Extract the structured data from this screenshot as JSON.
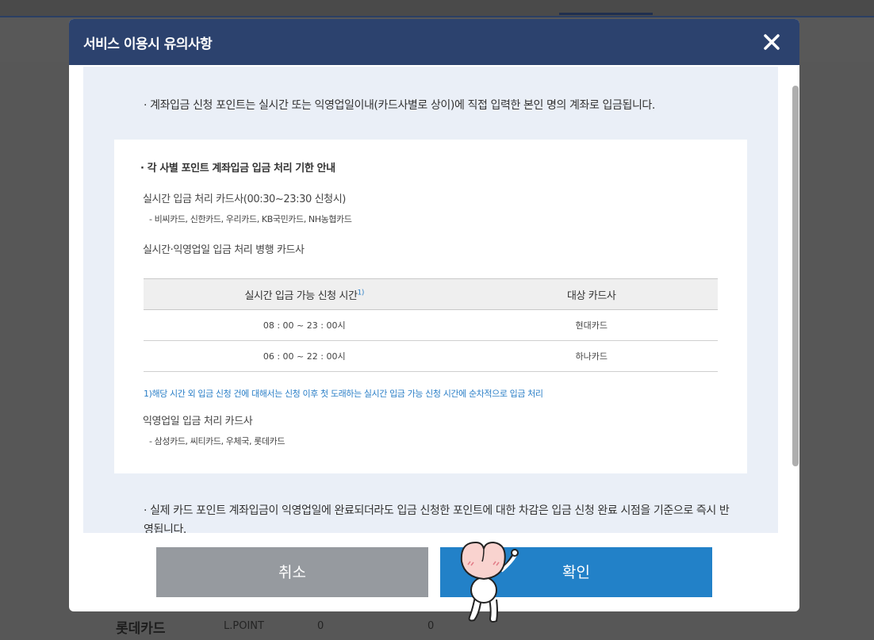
{
  "background": {
    "row": {
      "card_name": "롯데카드",
      "point_name": "L.POINT",
      "value1": "0",
      "value2": "0"
    }
  },
  "modal": {
    "title": "서비스 이용시 유의사항",
    "close_icon": "close-icon",
    "note_top": "· 계좌입금 신청 포인트는 실시간 또는 익영업일이내(카드사별로 상이)에 직접 입력한 본인 명의 계좌로 입금됩니다.",
    "box": {
      "heading": "· 각 사별 포인트 계좌입금 입금 처리 기한 안내",
      "realtime_title": "실시간 입금 처리 카드사(00:30~23:30 신청시)",
      "realtime_cards": "- 비씨카드, 신한카드, 우리카드, KB국민카드, NH농협카드",
      "parallel_title": "실시간·익영업일 입금 처리 병행 카드사",
      "table": {
        "headers": [
          "실시간 입금 가능 신청 시간",
          "대상 카드사"
        ],
        "header_sup": "1)",
        "rows": [
          [
            "08 : 00 ~ 23 : 00시",
            "현대카드"
          ],
          [
            "06 : 00 ~ 22 : 00시",
            "하나카드"
          ]
        ]
      },
      "footnote": "1)해당 시간 외 입금 신청 건에 대해서는 신청 이후 첫 도래하는 실시간 입금 가능 신청 시간에 순차적으로 입금 처리",
      "offday_title": "익영업일 입금 처리 카드사",
      "offday_cards": "- 삼성카드, 씨티카드, 우체국, 롯데카드"
    },
    "note_bottom": "· 실제 카드 포인트 계좌입금이 익영업일에 완료되더라도 입금 신청한 포인트에 대한 차감은 입금 신청 완료 시점을 기준으로 즉시 반영됩니다.",
    "cancel_label": "취소",
    "ok_label": "확인"
  },
  "colors": {
    "header": "#2c426e",
    "ok_button": "#2281c8",
    "cancel_button": "#969a9f",
    "scroll_bg": "#eaeff7",
    "footnote": "#2b7fc7"
  }
}
